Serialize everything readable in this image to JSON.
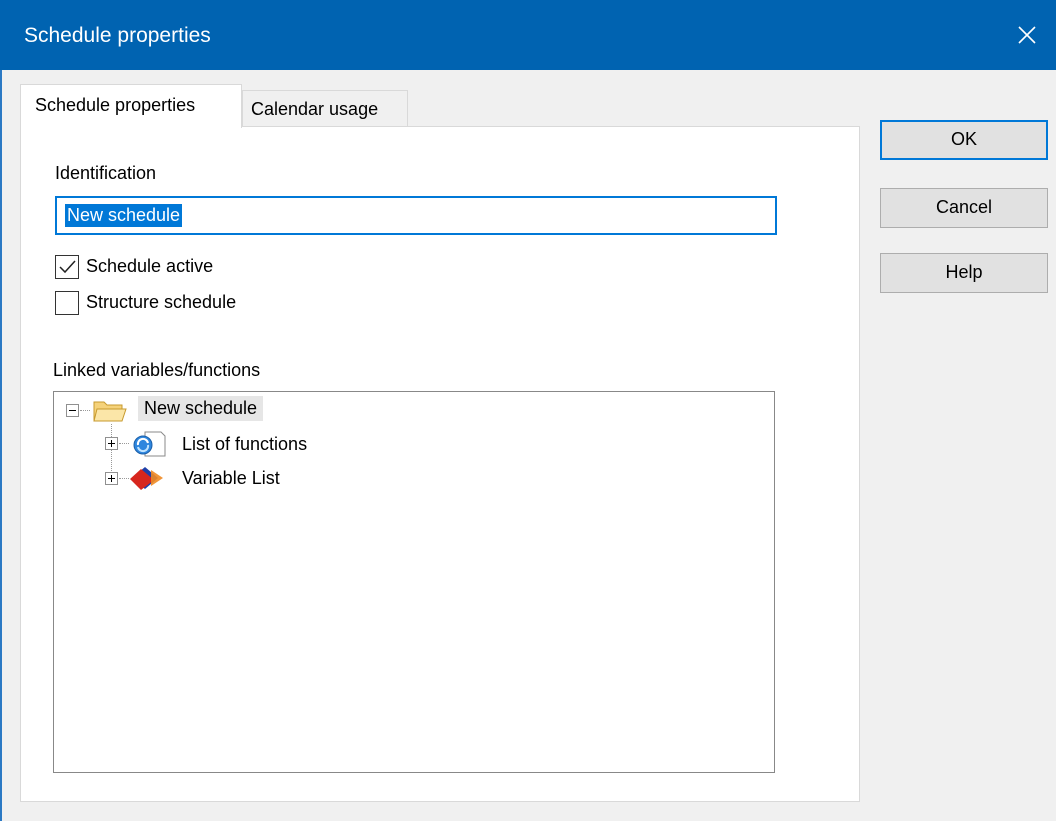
{
  "window": {
    "title": "Schedule properties"
  },
  "tabs": [
    {
      "label": "Schedule properties",
      "active": true
    },
    {
      "label": "Calendar usage",
      "active": false
    }
  ],
  "form": {
    "identification_label": "Identification",
    "identification_value": "New schedule",
    "schedule_active": {
      "label": "Schedule active",
      "checked": true
    },
    "structure_schedule": {
      "label": "Structure schedule",
      "checked": false
    },
    "linked_label": "Linked variables/functions"
  },
  "tree": {
    "root": {
      "label": "New schedule",
      "icon": "folder-open-icon",
      "expanded": true
    },
    "children": [
      {
        "label": "List of functions",
        "icon": "function-list-icon",
        "expanded": false
      },
      {
        "label": "Variable List",
        "icon": "variable-list-icon",
        "expanded": false
      }
    ]
  },
  "buttons": {
    "ok": "OK",
    "cancel": "Cancel",
    "help": "Help"
  },
  "colors": {
    "titlebar": "#0063b1",
    "accent": "#0078d7"
  }
}
